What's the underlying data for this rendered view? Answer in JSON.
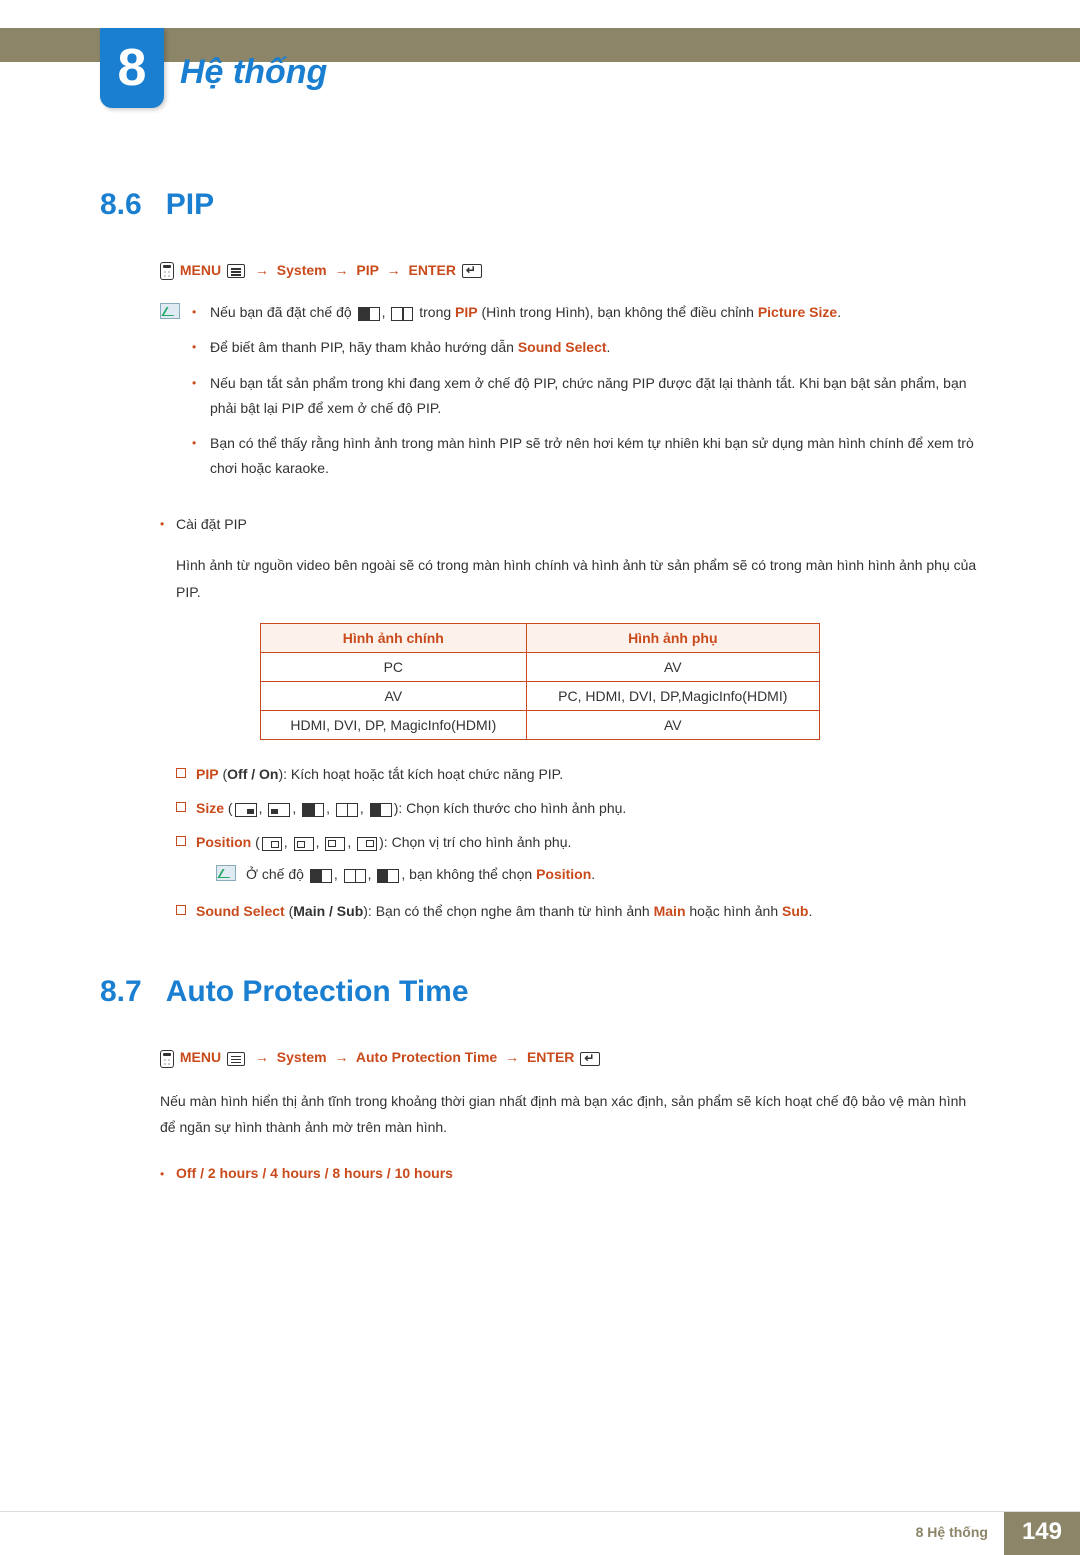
{
  "chapter": {
    "number": "8",
    "title": "Hệ thống"
  },
  "section1": {
    "num": "8.6",
    "title": "PIP",
    "menu": {
      "remote": "MENU",
      "path": [
        "System",
        "PIP",
        "ENTER"
      ]
    },
    "notes": {
      "n1a": "Nếu bạn đã đặt chế độ ",
      "n1b": " trong ",
      "n1_pip": "PIP",
      "n1c": " (Hình trong Hình), bạn không thể điều chỉnh ",
      "n1_ps": "Picture Size",
      "n1d": ".",
      "n2a": "Để biết âm thanh PIP, hãy tham khảo hướng dẫn ",
      "n2_ss": "Sound Select",
      "n2b": ".",
      "n3": "Nếu bạn tắt sản phẩm trong khi đang xem ở chế độ PIP, chức năng PIP được đặt lại thành tắt. Khi bạn bật sản phẩm, bạn phải bật lại PIP để xem ở chế độ PIP.",
      "n4": "Bạn có thể thấy rằng hình ảnh trong màn hình PIP sẽ trở nên hơi kém tự nhiên khi bạn sử dụng màn hình chính để xem trò chơi hoặc karaoke."
    },
    "pip_setting_label": "Cài đặt PIP",
    "pip_setting_text": "Hình ảnh từ nguồn video bên ngoài sẽ có trong màn hình chính và hình ảnh từ sản phẩm sẽ có trong màn hình hình ảnh phụ của PIP.",
    "table": {
      "h1": "Hình ảnh chính",
      "h2": "Hình ảnh phụ",
      "rows": [
        {
          "c1": "PC",
          "c2": "AV"
        },
        {
          "c1": "AV",
          "c2": "PC, HDMI, DVI, DP,MagicInfo(HDMI)"
        },
        {
          "c1": "HDMI, DVI, DP, MagicInfo(HDMI)",
          "c2": "AV"
        }
      ]
    },
    "opts": {
      "pip": {
        "label": "PIP",
        "vals": "Off / On",
        "suffix": "): Kích hoạt hoặc tắt kích hoạt chức năng PIP."
      },
      "size": {
        "label": "Size",
        "suffix": "): Chọn kích thước cho hình ảnh phụ."
      },
      "position": {
        "label": "Position",
        "suffix": "): Chọn vị trí cho hình ảnh phụ."
      },
      "pos_note_a": "Ở chế độ ",
      "pos_note_b": ", bạn không thể chọn ",
      "pos_note_c": "Position",
      "pos_note_d": ".",
      "sound": {
        "label": "Sound Select",
        "vals": "Main / Sub",
        "text_a": "): Bạn có thể chọn nghe âm thanh từ hình ảnh ",
        "main": "Main",
        "text_b": " hoặc hình ảnh ",
        "sub": "Sub",
        "text_c": "."
      }
    }
  },
  "section2": {
    "num": "8.7",
    "title": "Auto Protection Time",
    "menu": {
      "remote": "MENU",
      "path": [
        "System",
        "Auto Protection Time",
        "ENTER"
      ]
    },
    "text": "Nếu màn hình hiển thị ảnh tĩnh trong khoảng thời gian nhất định mà bạn xác định, sản phẩm sẽ kích hoạt chế độ bảo vệ màn hình để ngăn sự hình thành ảnh mờ trên màn hình.",
    "options": "Off / 2 hours / 4 hours / 8 hours / 10 hours"
  },
  "footer": {
    "label": "8 Hệ thống",
    "page": "149"
  }
}
